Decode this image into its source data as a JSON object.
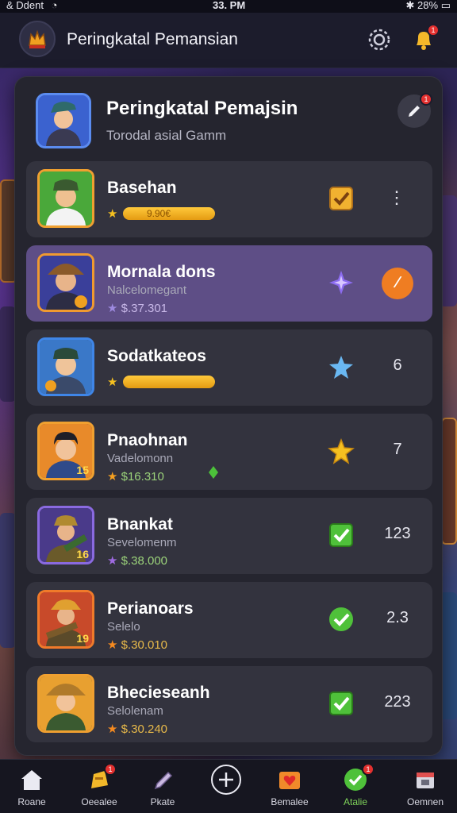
{
  "status_bar": {
    "carrier": "& Ddent",
    "time": "33. PM",
    "battery": "28%"
  },
  "header": {
    "title": "Peringkatal Pemansian",
    "bell_badge": "1"
  },
  "panel": {
    "title": "Peringkatal Pemajsin",
    "subtitle": "Torodal asial Gamm",
    "edit_badge": "1"
  },
  "players": [
    {
      "name": "Basehan",
      "subtitle": "",
      "stat": "9.90€",
      "bar_level": 1.0,
      "badge_icon": "checkbox-icon",
      "rank": "",
      "trailing": "more",
      "avatar_number": ""
    },
    {
      "name": "Mornala dons",
      "subtitle": "Nalcelomegant",
      "stat": "$.37.301",
      "badge_icon": "purple-star-icon",
      "rank": "",
      "trailing": "action",
      "action_label": "∕",
      "avatar_number": ""
    },
    {
      "name": "Sodatkateos",
      "subtitle": "",
      "stat": "",
      "bar_level": 1.0,
      "badge_icon": "blue-star-icon",
      "rank": "6",
      "trailing": "rank",
      "avatar_number": ""
    },
    {
      "name": "Pnaohnan",
      "subtitle": "Vadelomonn",
      "stat": "$16.310",
      "badge_icon": "gold-star-icon",
      "rank": "7",
      "trailing": "rank",
      "avatar_number": "15"
    },
    {
      "name": "Bnankat",
      "subtitle": "Sevelomenm",
      "stat": "$.38.000",
      "badge_icon": "green-check-icon",
      "rank": "123",
      "trailing": "rank",
      "avatar_number": "16"
    },
    {
      "name": "Perianoars",
      "subtitle": "Selelo",
      "stat": "$.30.010",
      "badge_icon": "green-check-circle-icon",
      "rank": "2.3",
      "trailing": "rank",
      "avatar_number": "19"
    },
    {
      "name": "Bhecieseanh",
      "subtitle": "Selolenam",
      "stat": "$.30.240",
      "badge_icon": "green-check-icon",
      "rank": "223",
      "trailing": "rank",
      "avatar_number": ""
    }
  ],
  "bottom_nav": [
    {
      "label": "Roane",
      "icon": "home-icon"
    },
    {
      "label": "Oeealee",
      "icon": "trophy-icon",
      "badge": "1"
    },
    {
      "label": "Pkate",
      "icon": "pencil-icon"
    },
    {
      "label": "",
      "icon": "plus-circle-icon"
    },
    {
      "label": "Bemalee",
      "icon": "heart-box-icon"
    },
    {
      "label": "Atalie",
      "icon": "check-badge-icon",
      "badge": "1"
    },
    {
      "label": "Oemnen",
      "icon": "calendar-icon"
    }
  ],
  "colors": {
    "accent_orange": "#ef7d22",
    "active_row": "#5e4e86",
    "gold": "#f5c020",
    "green": "#4fc13a"
  }
}
